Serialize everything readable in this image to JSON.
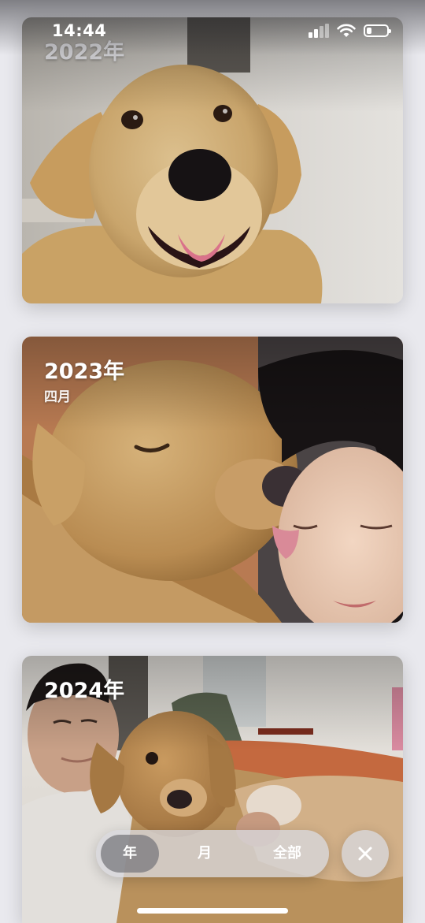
{
  "status_bar": {
    "time": "14:44",
    "icons": [
      "cellular-signal-icon",
      "wifi-icon",
      "battery-icon"
    ],
    "battery_level": 0.25
  },
  "cards": [
    {
      "year": "2022年",
      "month": ""
    },
    {
      "year": "2023年",
      "month": "四月"
    },
    {
      "year": "2024年",
      "month": ""
    }
  ],
  "segmented_control": {
    "items": [
      {
        "label": "年",
        "selected": true
      },
      {
        "label": "月",
        "selected": false
      },
      {
        "label": "全部",
        "selected": false
      }
    ]
  },
  "close_button": {
    "icon": "close-icon"
  },
  "colors": {
    "background": "#e9e9ee",
    "control_bg": "#d7d7dc",
    "control_active": "#78787d",
    "text_on_photo": "#ffffff"
  }
}
